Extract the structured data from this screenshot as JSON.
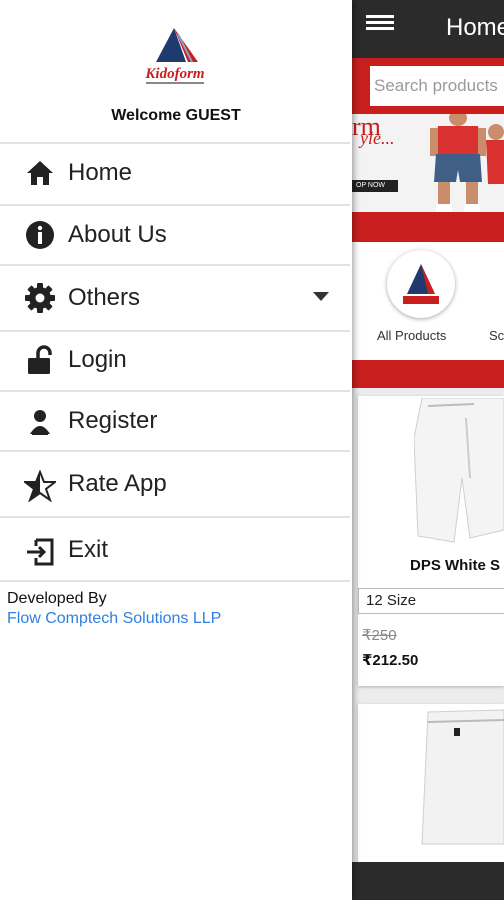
{
  "app": {
    "title": "Home",
    "search": {
      "placeholder": "Search products"
    },
    "banner": {
      "text_line1": "rm",
      "text_line2": "yle...",
      "button": "OP NOW"
    },
    "categories": [
      {
        "label": "All Products"
      },
      {
        "label": "Sc"
      }
    ],
    "products": [
      {
        "name": "DPS White S",
        "size": "12 Size",
        "price_old": "₹250",
        "price_new": "₹212.50"
      }
    ]
  },
  "drawer": {
    "logo_text": "Kidoform",
    "welcome": "Welcome GUEST",
    "items": [
      {
        "label": "Home",
        "icon": "home-icon"
      },
      {
        "label": "About Us",
        "icon": "info-icon"
      },
      {
        "label": "Others",
        "icon": "gear-icon"
      },
      {
        "label": "Login",
        "icon": "unlock-icon"
      },
      {
        "label": "Register",
        "icon": "person-icon"
      },
      {
        "label": "Rate App",
        "icon": "star-half-icon"
      },
      {
        "label": "Exit",
        "icon": "exit-icon"
      }
    ],
    "developed_by": "Developed By",
    "developer": "Flow Comptech Solutions LLP"
  },
  "colors": {
    "accent_red": "#c81e1e",
    "appbar": "#2b2b2b",
    "link_blue": "#2f7fe2"
  }
}
